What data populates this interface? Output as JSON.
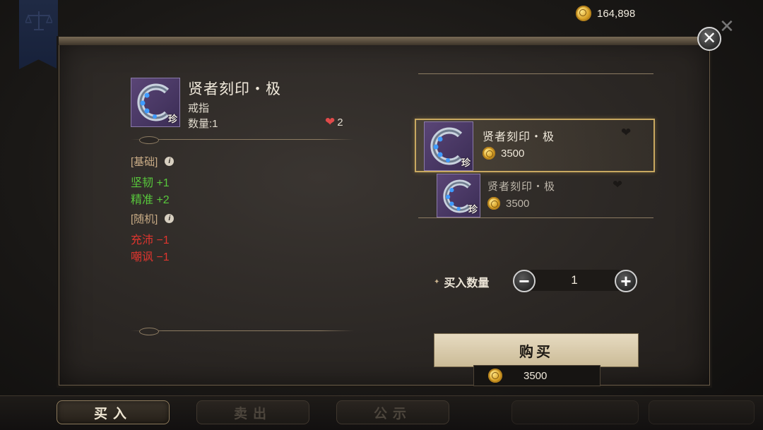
{
  "currency": {
    "gold_amount": "164,898",
    "icon": "gold-coin-icon"
  },
  "detail": {
    "item_name": "贤者刻印・极",
    "item_type": "戒指",
    "quantity_label": "数量:1",
    "favorites_count": "2",
    "rarity_badge": "珍",
    "base_section": "[基础]",
    "base_stats": [
      "坚韧 +1",
      "精准 +2"
    ],
    "random_section": "[随机]",
    "random_stats": [
      "充沛 −1",
      "嘲讽 −1"
    ],
    "info_icon": "i"
  },
  "listings": [
    {
      "name": "贤者刻印・极",
      "price": "3500",
      "badge": "珍",
      "selected": true
    },
    {
      "name": "贤者刻印・极",
      "price": "3500",
      "badge": "珍",
      "selected": false
    }
  ],
  "purchase": {
    "quantity_label": "买入数量",
    "quantity_value": "1",
    "minus": "−",
    "plus": "+",
    "buy_label": "购买",
    "total_price": "3500"
  },
  "tabs": [
    {
      "label": "买入",
      "active": true
    },
    {
      "label": "卖出",
      "active": false
    },
    {
      "label": "公示",
      "active": false
    }
  ],
  "colors": {
    "accent_gold": "#c8a860",
    "positive_stat": "#58c83c",
    "negative_stat": "#e0352e",
    "item_frame": "#5a4576"
  }
}
